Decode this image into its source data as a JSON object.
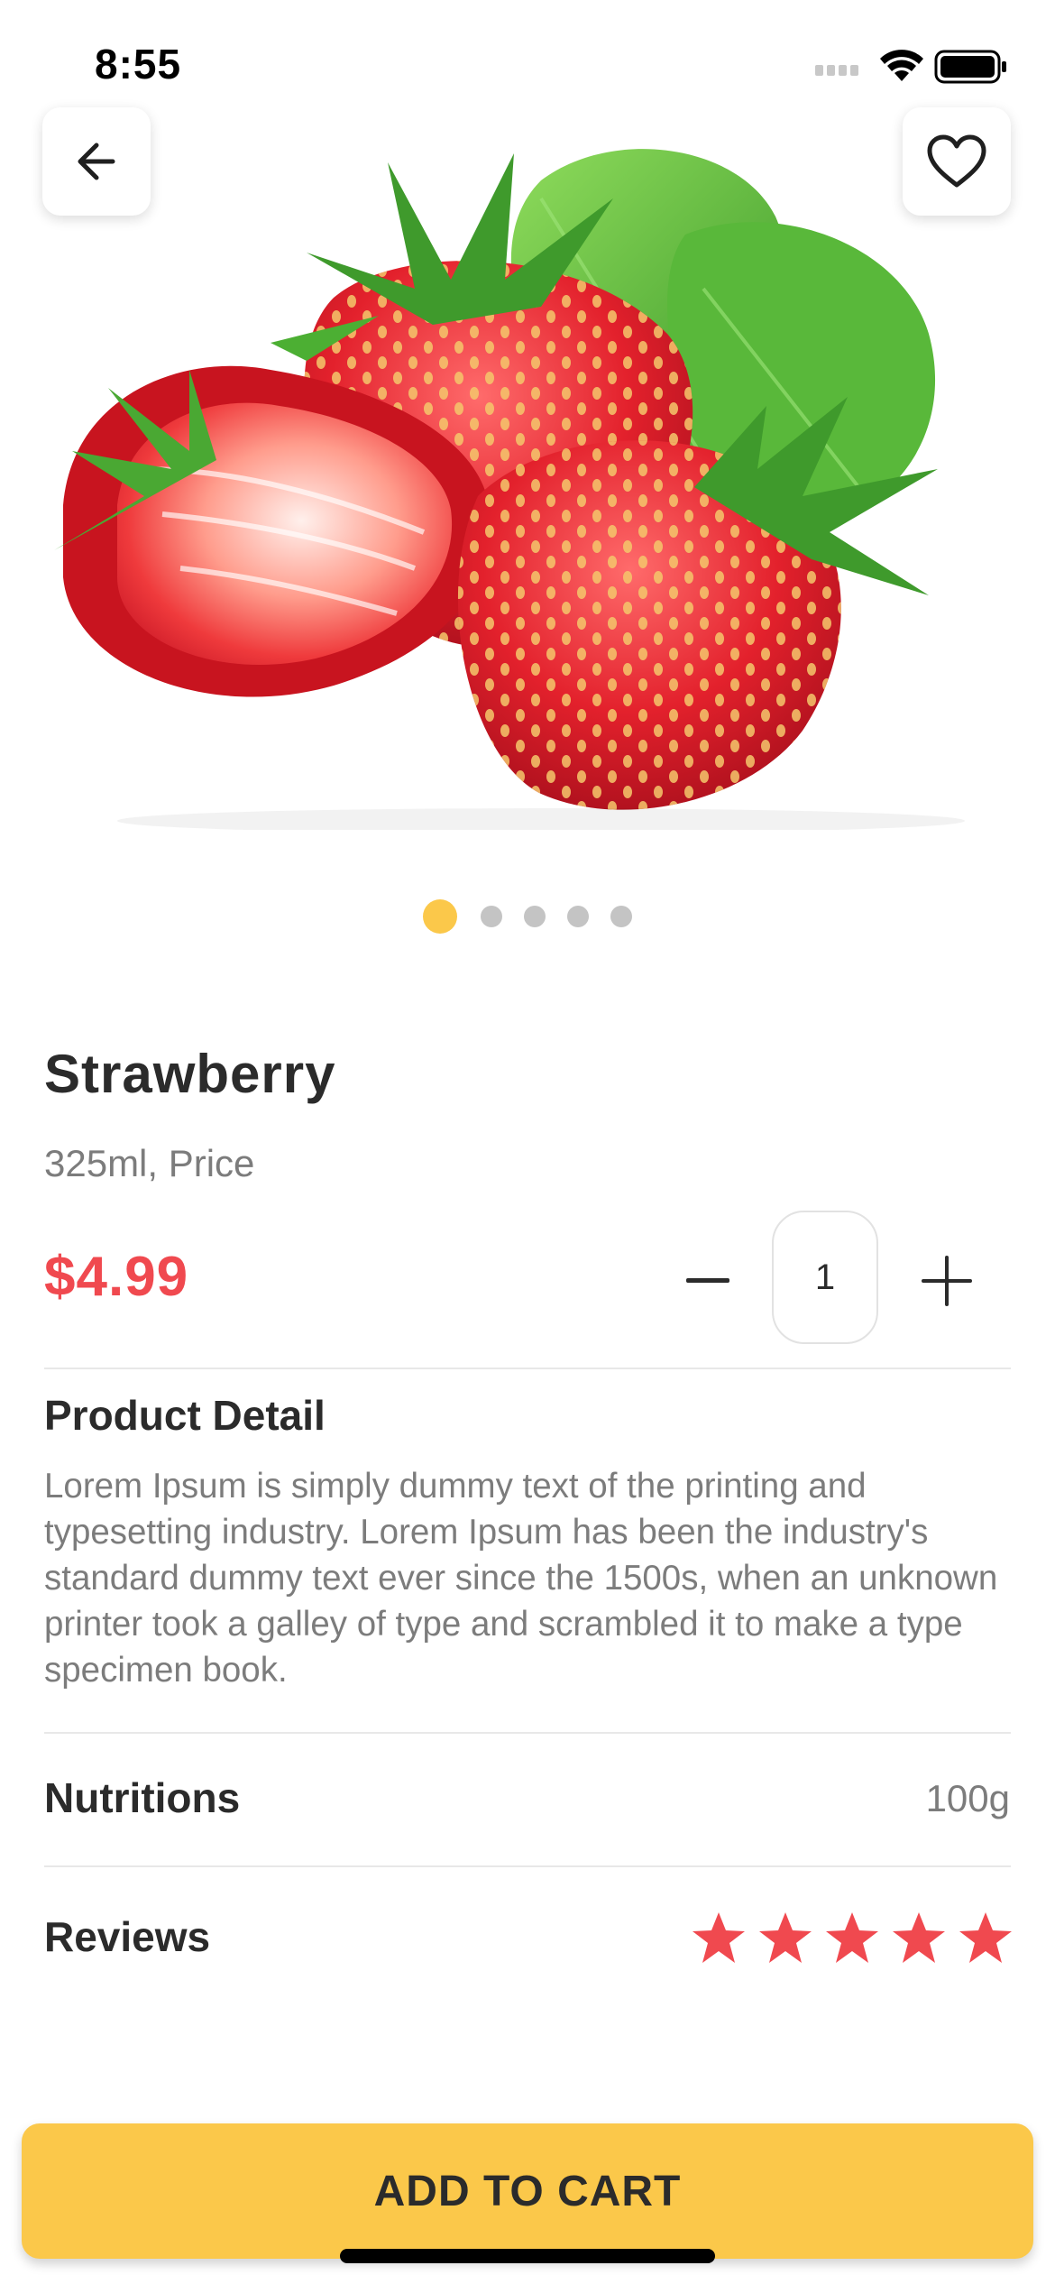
{
  "status_bar": {
    "time": "8:55",
    "icons": [
      "signal-icon",
      "wifi-icon",
      "battery-icon"
    ]
  },
  "header": {
    "back_icon": "arrow-left-icon",
    "favorite_icon": "heart-outline-icon"
  },
  "product": {
    "image_subject": "strawberries",
    "carousel": {
      "count": 5,
      "active_index": 0
    },
    "name": "Strawberry",
    "subtitle": "325ml, Price",
    "price": "$4.99",
    "quantity": "1"
  },
  "detail": {
    "title": "Product Detail",
    "text": "Lorem Ipsum is simply dummy text of the printing and typesetting industry. Lorem Ipsum has been the industry's standard dummy text ever since the 1500s, when an unknown printer took a galley of type and scrambled it to make a type specimen book."
  },
  "nutritions": {
    "label": "Nutritions",
    "value": "100g"
  },
  "reviews": {
    "label": "Reviews",
    "rating": 5,
    "max": 5
  },
  "cta": {
    "label": "ADD TO CART"
  },
  "colors": {
    "accent": "#fbc84a",
    "price": "#f0494f",
    "star": "#f0494f",
    "text_primary": "#2b2b2b",
    "text_secondary": "#7c7c7c"
  }
}
